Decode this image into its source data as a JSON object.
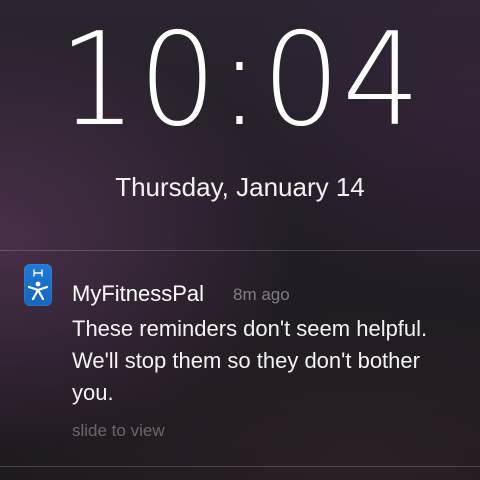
{
  "lockscreen": {
    "time": "10:04",
    "date": "Thursday, January 14"
  },
  "notification": {
    "app_icon": "myfitnesspal-app-icon",
    "app_name": "MyFitnessPal",
    "time_ago": "8m ago",
    "message": "These reminders don't seem helpful. We'll stop them so they don't bother you.",
    "action_hint": "slide to view"
  },
  "colors": {
    "app_icon_blue": "#1b70cc",
    "text_primary": "#ffffff",
    "text_secondary": "rgba(255,255,255,0.42)",
    "background": "#221d24"
  }
}
